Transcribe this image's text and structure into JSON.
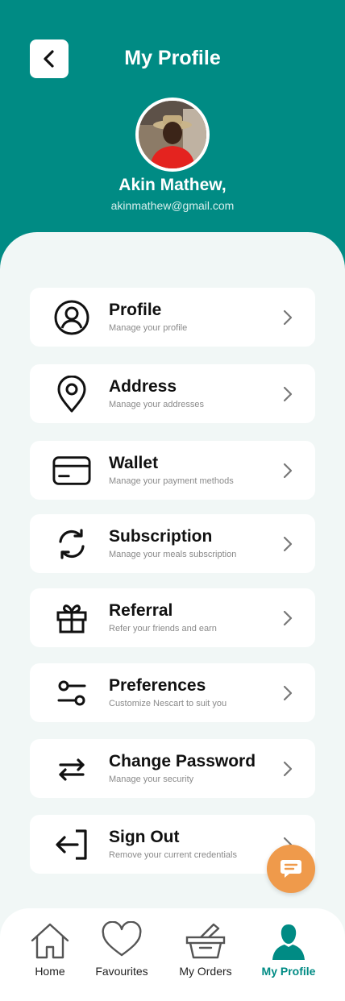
{
  "header": {
    "title": "My Profile",
    "user_name": "Akin Mathew,",
    "user_email": "akinmathew@gmail.com"
  },
  "menu": [
    {
      "title": "Profile",
      "subtitle": "Manage your profile",
      "icon": "user-circle-icon"
    },
    {
      "title": "Address",
      "subtitle": "Manage your addresses",
      "icon": "location-pin-icon"
    },
    {
      "title": "Wallet",
      "subtitle": "Manage your payment methods",
      "icon": "credit-card-icon"
    },
    {
      "title": "Subscription",
      "subtitle": "Manage your meals subscription",
      "icon": "refresh-icon"
    },
    {
      "title": "Referral",
      "subtitle": "Refer your friends and earn",
      "icon": "gift-icon"
    },
    {
      "title": "Preferences",
      "subtitle": "Customize Nescart to suit you",
      "icon": "settings-sliders-icon"
    },
    {
      "title": "Change Password",
      "subtitle": "Manage your security",
      "icon": "swap-arrows-icon"
    },
    {
      "title": "Sign Out",
      "subtitle": "Remove your current credentials",
      "icon": "logout-icon"
    }
  ],
  "nav": {
    "items": [
      {
        "label": "Home",
        "icon": "home-icon"
      },
      {
        "label": "Favourites",
        "icon": "heart-icon"
      },
      {
        "label": "My Orders",
        "icon": "basket-icon"
      },
      {
        "label": "My Profile",
        "icon": "person-icon"
      }
    ],
    "active": "My Profile"
  },
  "colors": {
    "primary": "#008b84",
    "accent": "#ef9a4b",
    "background": "#f1f7f6"
  }
}
